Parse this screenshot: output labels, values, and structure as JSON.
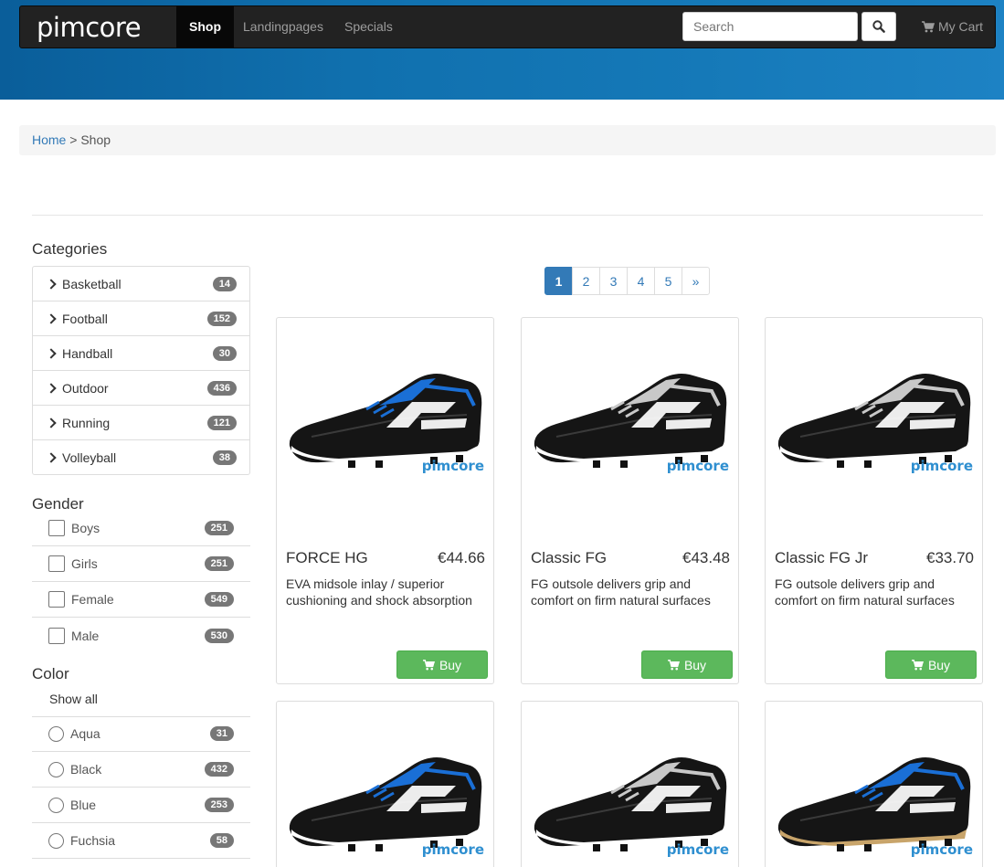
{
  "brand": {
    "logo_text": "pimcore"
  },
  "nav": {
    "items": [
      {
        "label": "Shop",
        "active": true
      },
      {
        "label": "Landingpages",
        "active": false
      },
      {
        "label": "Specials",
        "active": false
      }
    ],
    "search_placeholder": "Search",
    "cart_label": "My Cart"
  },
  "breadcrumb": {
    "home": "Home",
    "separator": ">",
    "current": "Shop"
  },
  "sidebar": {
    "categories_title": "Categories",
    "categories": [
      {
        "label": "Basketball",
        "count": "14"
      },
      {
        "label": "Football",
        "count": "152"
      },
      {
        "label": "Handball",
        "count": "30"
      },
      {
        "label": "Outdoor",
        "count": "436"
      },
      {
        "label": "Running",
        "count": "121"
      },
      {
        "label": "Volleyball",
        "count": "38"
      }
    ],
    "gender_title": "Gender",
    "gender": [
      {
        "label": "Boys",
        "count": "251"
      },
      {
        "label": "Girls",
        "count": "251"
      },
      {
        "label": "Female",
        "count": "549"
      },
      {
        "label": "Male",
        "count": "530"
      }
    ],
    "color_title": "Color",
    "color_show_all": "Show all",
    "colors": [
      {
        "label": "Aqua",
        "count": "31"
      },
      {
        "label": "Black",
        "count": "432"
      },
      {
        "label": "Blue",
        "count": "253"
      },
      {
        "label": "Fuchsia",
        "count": "58"
      }
    ]
  },
  "pagination": {
    "pages": [
      "1",
      "2",
      "3",
      "4",
      "5"
    ],
    "next": "»",
    "current": "1"
  },
  "products": [
    {
      "name": "FORCE HG",
      "price": "€44.66",
      "description": "EVA midsole inlay / superior cushioning and shock absorption",
      "buy_label": "Buy",
      "accent": "#1a6fd6",
      "sole": "#ffffff",
      "logo": "pimcore"
    },
    {
      "name": "Classic FG",
      "price": "€43.48",
      "description": "FG outsole delivers grip and comfort on firm natural surfaces",
      "buy_label": "Buy",
      "accent": "#c8c8c8",
      "sole": "#ffffff",
      "logo": "pimcore"
    },
    {
      "name": "Classic FG Jr",
      "price": "€33.70",
      "description": "FG outsole delivers grip and comfort on firm natural surfaces",
      "buy_label": "Buy",
      "accent": "#c8c8c8",
      "sole": "#ffffff",
      "logo": "pimcore"
    },
    {
      "name": "",
      "price": "",
      "description": "",
      "buy_label": "",
      "accent": "#1a6fd6",
      "sole": "#ffffff",
      "logo": "pimcore"
    },
    {
      "name": "",
      "price": "",
      "description": "",
      "buy_label": "",
      "accent": "#c8c8c8",
      "sole": "#ffffff",
      "logo": "pimcore"
    },
    {
      "name": "",
      "price": "",
      "description": "",
      "buy_label": "",
      "accent": "#1a6fd6",
      "sole": "#c8a46a",
      "logo": "pimcore"
    }
  ],
  "colors": {
    "brand_blue": "#337ab7",
    "buy_green": "#5cb85c",
    "navbar": "#222222",
    "hero": "#1070ae"
  }
}
